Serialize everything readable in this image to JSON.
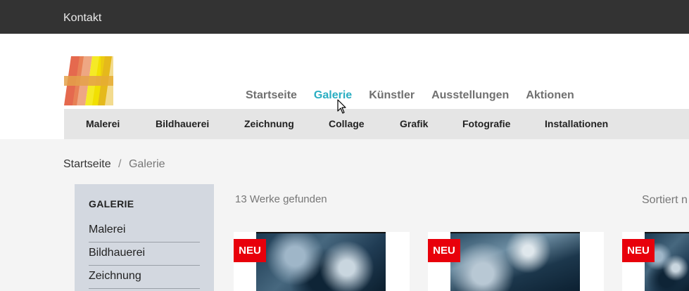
{
  "topbar": {
    "contact_label": "Kontakt"
  },
  "main_nav": [
    {
      "label": "Startseite",
      "active": false
    },
    {
      "label": "Galerie",
      "active": true
    },
    {
      "label": "Künstler",
      "active": false
    },
    {
      "label": "Ausstellungen",
      "active": false
    },
    {
      "label": "Aktionen",
      "active": false
    }
  ],
  "sub_nav": [
    "Malerei",
    "Bildhauerei",
    "Zeichnung",
    "Collage",
    "Grafik",
    "Fotografie",
    "Installationen"
  ],
  "breadcrumb": {
    "home": "Startseite",
    "separator": "/",
    "current": "Galerie"
  },
  "sidebar": {
    "title": "GALERIE",
    "categories": [
      "Malerei",
      "Bildhauerei",
      "Zeichnung"
    ]
  },
  "results": {
    "count_text": "13 Werke gefunden",
    "sort_text": "Sortiert n"
  },
  "cards": [
    {
      "badge": "NEU"
    },
    {
      "badge": "NEU"
    },
    {
      "badge": "NEU"
    }
  ],
  "colors": {
    "accent": "#2aaec2",
    "badge": "#e8000b",
    "topbar": "#333333",
    "sidebar": "#d3d8e0"
  },
  "icons": {
    "cursor": "mouse-pointer-icon",
    "logo": "gallery-logo"
  }
}
